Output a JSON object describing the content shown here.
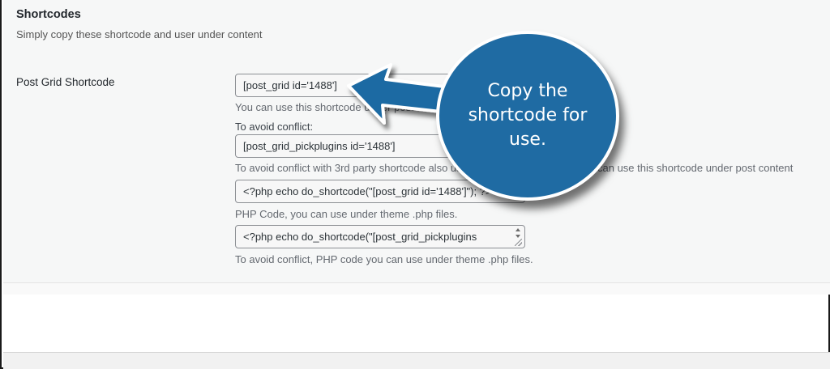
{
  "section": {
    "title": "Shortcodes",
    "description": "Simply copy these shortcode and user under content"
  },
  "post_grid": {
    "label": "Post Grid Shortcode",
    "shortcode_value": "[post_grid id='1488']",
    "shortcode_help": "You can use this shortcode under post content",
    "avoid_conflict_heading": "To avoid conflict:",
    "alt_shortcode_value": "[post_grid_pickplugins id='1488']",
    "alt_shortcode_help_start": "To avoid conflict with 3rd party shortcode also use",
    "alt_shortcode_help_end": "can use this shortcode under post content",
    "php_value": "<?php echo do_shortcode(\"[post_grid id='1488']\"); ?>",
    "php_help": "PHP Code, you can use under theme .php files.",
    "alt_php_value": "<?php echo do_shortcode(\"[post_grid_pickplugins",
    "alt_php_help": "To avoid conflict, PHP code you can use under theme .php files."
  },
  "callout": {
    "text": "Copy the shortcode for use.",
    "color": "#1f6ba3",
    "icon": "arrow-left-icon"
  }
}
